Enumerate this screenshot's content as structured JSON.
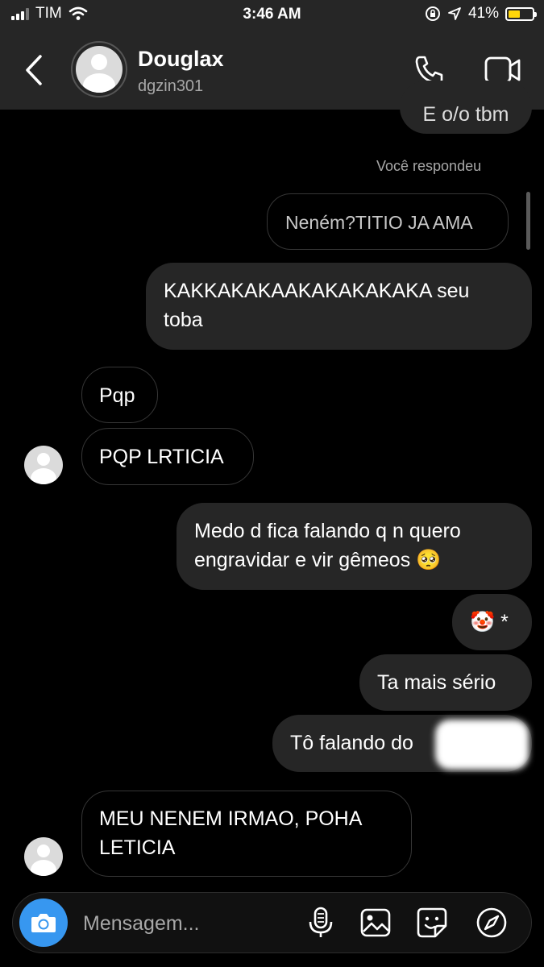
{
  "status_bar": {
    "carrier": "TIM",
    "time": "3:46 AM",
    "battery_percent": "41%",
    "battery_level": 0.41,
    "signal_bars": 3
  },
  "header": {
    "name": "Douglax",
    "username": "dgzin301",
    "icons": [
      "back-chevron",
      "avatar",
      "phone-call",
      "video-call"
    ]
  },
  "chat": {
    "cut_off_top_text": "E o/o tbm",
    "replied_label": "Você respondeu",
    "quoted_message": "Neném?TITIO JA AMA",
    "messages": [
      {
        "id": "m1",
        "side": "outgoing",
        "lines": [
          "KAKKAKAKAAKAKAKAKAKA seu",
          "toba"
        ]
      },
      {
        "id": "m2",
        "side": "incoming",
        "lines": [
          "Pqp"
        ]
      },
      {
        "id": "m3",
        "side": "incoming",
        "lines": [
          "PQP LRTICIA"
        ]
      },
      {
        "id": "m4",
        "side": "outgoing",
        "lines": [
          "Medo d fica falando q n quero",
          "engravidar e vir gêmeos 🥺"
        ]
      },
      {
        "id": "m5",
        "side": "outgoing",
        "lines": [
          "🤡 *"
        ]
      },
      {
        "id": "m6",
        "side": "outgoing",
        "lines": [
          "Ta mais sério"
        ]
      },
      {
        "id": "m7",
        "side": "outgoing",
        "lines": [
          "Tô falando do"
        ]
      },
      {
        "id": "m8",
        "side": "incoming",
        "lines": [
          "MEU NENEM IRMAO, POHA",
          "LETICIA"
        ]
      }
    ]
  },
  "composer": {
    "placeholder": "Mensagem...",
    "icons": [
      "camera",
      "microphone",
      "gallery",
      "sticker",
      "compass"
    ]
  },
  "colors": {
    "background": "#000000",
    "bar": "#262626",
    "outgoing_bubble": "#262626",
    "incoming_border": "#363636",
    "camera_button": "#3797f0",
    "battery_fill": "#ffd60a",
    "secondary_text": "#a8a8a8"
  }
}
